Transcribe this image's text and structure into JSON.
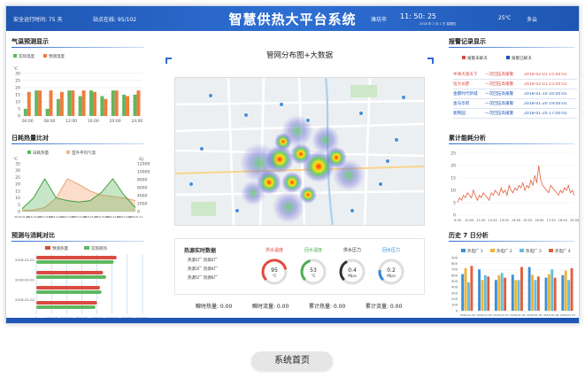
{
  "header": {
    "runtime_label": "安全运行时间: 75 天",
    "stations_label": "站点在线: 95/102",
    "title": "智慧供热大平台系统",
    "city": "潍坊市",
    "time": "11: 50: 25",
    "date": "2018 年 2 月 1 日  星期四",
    "temperature": "25℃",
    "weather": "多云"
  },
  "temp_forecast": {
    "title": "气温预测显示",
    "legend": [
      "实际温度",
      "预测温度"
    ],
    "colors": {
      "actual": "#5fb85f",
      "forecast": "#f07c3c"
    },
    "y_unit": "℃",
    "chart_data": {
      "type": "bar",
      "categories": [
        "04:00",
        "",
        "08:00",
        "",
        "12:00",
        "",
        "16:00",
        "",
        "20:00",
        "",
        "24:00"
      ],
      "y_ticks": [
        "0",
        "5",
        "10",
        "15",
        "20",
        "25",
        "30"
      ],
      "ylim": [
        0,
        30
      ],
      "series": [
        {
          "name": "实际温度",
          "values": [
            5,
            18,
            5,
            12,
            18,
            14,
            18,
            14,
            18,
            15,
            15
          ]
        },
        {
          "name": "预测温度",
          "values": [
            17,
            18,
            18,
            17,
            18,
            18,
            17,
            12,
            18,
            14,
            18
          ]
        }
      ]
    }
  },
  "daily_heat": {
    "title": "日耗热量比对",
    "legend": [
      "日耗热量",
      "室外平均气温"
    ],
    "left_unit": "℃",
    "right_unit": "GJ",
    "chart_data": {
      "type": "area",
      "x": [
        "2018-01-01",
        "2018-01-02",
        "2018-01-03",
        "2018-01-04",
        "2018-01-05",
        "2018-01-06",
        "2018-01-07",
        "2018-01-08",
        "2018-01-09",
        "2018-01-10",
        "2018-01-11"
      ],
      "left_ticks": [
        "0",
        "5",
        "10",
        "15",
        "20",
        "25",
        "30",
        "35"
      ],
      "right_ticks": [
        "0",
        "2000",
        "4000",
        "6000",
        "8000",
        "10000",
        "12000"
      ],
      "ylim": [
        0,
        35
      ],
      "series": [
        {
          "name": "日耗热量",
          "values": [
            2,
            10,
            24,
            10,
            8,
            7,
            8,
            14,
            24,
            12,
            3
          ]
        },
        {
          "name": "室外平均气温",
          "values": [
            1,
            1,
            3,
            10,
            24,
            20,
            15,
            12,
            11,
            10,
            8
          ]
        }
      ]
    }
  },
  "forecast_compare": {
    "title": "预测与消耗对比",
    "legend": [
      "预测热量",
      "实际耗热"
    ],
    "chart_data": {
      "type": "bar",
      "categories": [
        "2018-01-01",
        "2018-02-01",
        "2018-02-02"
      ],
      "x_ticks": [
        "0",
        "100000",
        "200000",
        "300000",
        "400000",
        "500000",
        "600000",
        "700000"
      ],
      "xlim": [
        0,
        700000
      ],
      "series": [
        {
          "name": "预测热量",
          "values": [
            530000,
            440000,
            420000,
            400000
          ]
        },
        {
          "name": "实际耗热",
          "values": [
            510000,
            460000,
            430000,
            390000
          ]
        }
      ]
    }
  },
  "map": {
    "title": "管网分布图+大数据"
  },
  "alarm": {
    "title": "报警记录显示",
    "legend": [
      "报警未解决",
      "报警已解决"
    ],
    "rows": [
      {
        "name": "中海大观天下",
        "type": "一次回压高报警",
        "time": "2018-02-01 15:00:01",
        "level": "red"
      },
      {
        "name": "恒大长郡",
        "type": "一次回压高报警",
        "time": "2018-02-01 15:00:01",
        "level": "red"
      },
      {
        "name": "金都时代新城",
        "type": "一次回压高报警",
        "time": "2018-01-10 16:00:01",
        "level": "blue"
      },
      {
        "name": "金马华府",
        "type": "一次回压高报警",
        "time": "2018-01-20 19:00:01",
        "level": "blue"
      },
      {
        "name": "紫荆园",
        "type": "一次回压高报警",
        "time": "2018-01-20 17:00:01",
        "level": "blue"
      }
    ]
  },
  "energy": {
    "title": "累计能耗分析",
    "chart_data": {
      "type": "line",
      "x_ticks": [
        "9:50",
        "10:50",
        "11:50",
        "12:50",
        "13:50",
        "14:50",
        "15:50",
        "16:50",
        "17:50",
        "18:50",
        "19:50"
      ],
      "y_ticks": [
        "0",
        "5",
        "10",
        "15",
        "20",
        "25"
      ],
      "ylim": [
        0,
        25
      ],
      "values": [
        5,
        7,
        6,
        8,
        7,
        9,
        8,
        7,
        10,
        8,
        6,
        8,
        7,
        9,
        8,
        7,
        6,
        9,
        8,
        10,
        9,
        8,
        11,
        9,
        10,
        8,
        12,
        10,
        9,
        11,
        10,
        12,
        11,
        13,
        10,
        12,
        11,
        14,
        12,
        16,
        13,
        20,
        14,
        12,
        11,
        10,
        9,
        12,
        11,
        10,
        9,
        8,
        10,
        9,
        11,
        10,
        12,
        9,
        10,
        8
      ]
    }
  },
  "history": {
    "title": "历史 7 日分析",
    "legend": [
      "热电厂 1",
      "热电厂 2",
      "热电厂 3",
      "热电厂 4"
    ],
    "colors": [
      "#3a8fd6",
      "#f0b432",
      "#5fbfe0",
      "#e0603c"
    ],
    "chart_data": {
      "type": "bar",
      "categories": [
        "2018-01-01",
        "2018-01-02",
        "2018-01-03",
        "2018-01-04",
        "2018-01-05",
        "2018-01-06",
        "2018-01-07"
      ],
      "y_ticks": [
        "0",
        "100",
        "200",
        "300",
        "400",
        "500",
        "600",
        "700",
        "800",
        "900"
      ],
      "ylim": [
        0,
        900
      ],
      "series": [
        {
          "name": "热电厂 1",
          "values": [
            620,
            700,
            520,
            610,
            740,
            560,
            600
          ]
        },
        {
          "name": "热电厂 2",
          "values": [
            720,
            520,
            600,
            520,
            610,
            620,
            680
          ]
        },
        {
          "name": "热电厂 3",
          "values": [
            480,
            600,
            640,
            520,
            520,
            700,
            520
          ]
        },
        {
          "name": "热电厂 4",
          "values": [
            760,
            580,
            560,
            740,
            580,
            560,
            720
          ]
        }
      ]
    }
  },
  "heat_source": {
    "title": "热源实时数据",
    "rows": [
      "热源1厂 热源2厂",
      "热源3厂 热源4厂",
      "热源5厂 热源6厂"
    ],
    "gauges": [
      {
        "label": "供水温度",
        "value": "95",
        "unit": "℃",
        "color": "#e34a3c",
        "fraction": 0.79
      },
      {
        "label": "回水温度",
        "value": "53",
        "unit": "℃",
        "color": "#4caf50",
        "fraction": 0.44
      },
      {
        "label": "供水压力",
        "value": "0.4",
        "unit": "Mpa",
        "color": "#333333",
        "fraction": 0.4
      },
      {
        "label": "回水压力",
        "value": "0.2",
        "unit": "Mpa",
        "color": "#2e88d6",
        "fraction": 0.2
      }
    ],
    "flows": [
      "瞬时热量:  0.00",
      "瞬时流量:  0.00",
      "累计热量:  0.00",
      "累计流量:  0.00"
    ]
  },
  "caption": "系统首页"
}
